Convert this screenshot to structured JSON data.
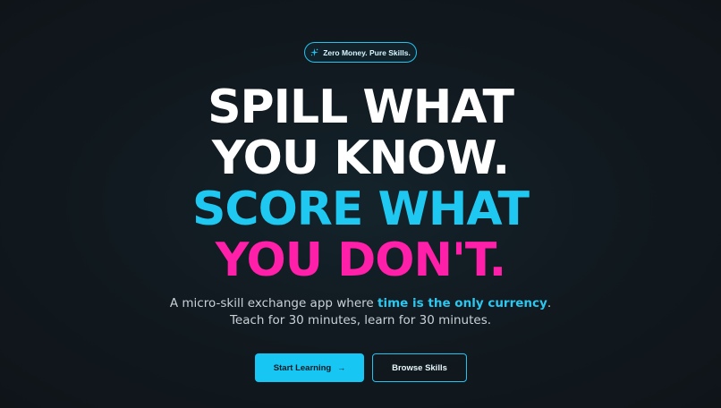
{
  "badge": {
    "icon": "sparkle-icon",
    "text": "Zero Money. Pure Skills."
  },
  "headline": {
    "line1": "SPILL WHAT",
    "line2": "YOU KNOW.",
    "line3_part1": "SCORE",
    "line3_part2": "WHAT",
    "line4": "YOU DON'T."
  },
  "subtitle": {
    "part1": "A micro-skill exchange app where ",
    "highlight": "time is the only currency",
    "part2": ".",
    "line2": "Teach for 30 minutes, learn for 30 minutes."
  },
  "buttons": {
    "primary_label": "Start Learning",
    "primary_icon": "arrow-right-icon",
    "secondary_label": "Browse Skills"
  },
  "colors": {
    "accent_cyan": "#1ec8f0",
    "accent_magenta": "#ff1fa8",
    "background": "#111a20"
  }
}
